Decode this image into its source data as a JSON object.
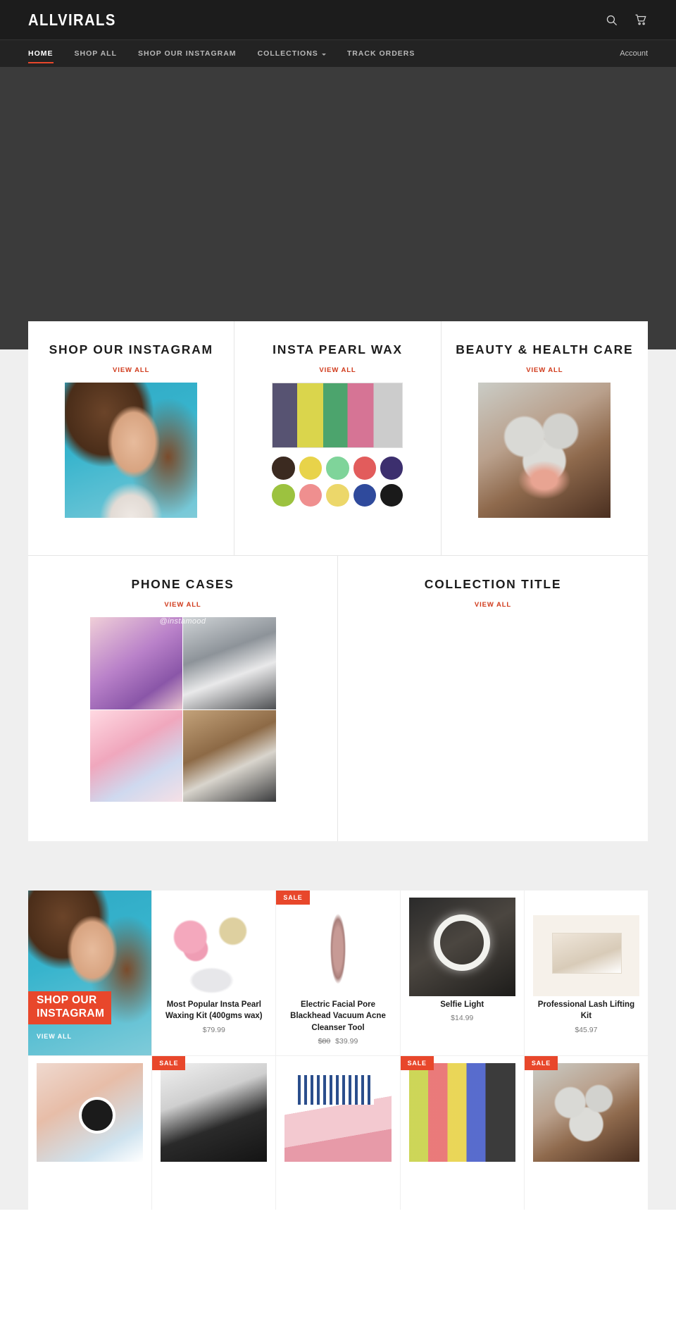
{
  "header": {
    "logo": "ALLVIRALS",
    "search_icon": "search-icon",
    "cart_icon": "cart-icon"
  },
  "nav": {
    "items": [
      {
        "label": "HOME",
        "active": true,
        "has_caret": false
      },
      {
        "label": "SHOP ALL",
        "active": false,
        "has_caret": false
      },
      {
        "label": "SHOP OUR INSTAGRAM",
        "active": false,
        "has_caret": false
      },
      {
        "label": "COLLECTIONS",
        "active": false,
        "has_caret": true
      },
      {
        "label": "TRACK ORDERS",
        "active": false,
        "has_caret": false
      }
    ],
    "account": "Account"
  },
  "collections": {
    "view_all": "VIEW ALL",
    "row1": [
      {
        "title": "SHOP OUR INSTAGRAM",
        "view_all": "VIEW ALL"
      },
      {
        "title": "INSTA PEARL WAX",
        "view_all": "VIEW ALL"
      },
      {
        "title": "BEAUTY & HEALTH CARE",
        "view_all": "VIEW ALL"
      }
    ],
    "row2": [
      {
        "title": "PHONE CASES",
        "view_all": "VIEW ALL"
      },
      {
        "title": "COLLECTION TITLE",
        "view_all": "VIEW ALL"
      }
    ],
    "wax_dot_colors": [
      "#3b2a20",
      "#e8d34a",
      "#7fd49a",
      "#e25c5c",
      "#3c2f6e",
      "#9cc23f",
      "#ef8f8f",
      "#ecd76a",
      "#2f4a9c",
      "#1a1a1a"
    ],
    "instamood_watermark": "@instamood"
  },
  "promo_tile": {
    "line1": "SHOP OUR",
    "line2": "INSTAGRAM",
    "view_all": "VIEW ALL"
  },
  "products": {
    "sale_label": "SALE",
    "row1": [
      {
        "title": "Most Popular Insta Pearl Waxing Kit (400gms wax)",
        "price": "$79.99",
        "was": "",
        "sale": false,
        "art": "art-wax"
      },
      {
        "title": "Electric Facial Pore Blackhead Vacuum Acne Cleanser Tool",
        "price": "$39.99",
        "was": "$80",
        "sale": true,
        "art": "art-vacuum"
      },
      {
        "title": "Selfie Light",
        "price": "$14.99",
        "was": "",
        "sale": false,
        "art": "art-selfie"
      },
      {
        "title": "Professional Lash Lifting Kit",
        "price": "$45.97",
        "was": "",
        "sale": false,
        "art": "art-lash"
      }
    ],
    "row2": [
      {
        "title": "",
        "price": "",
        "was": "",
        "sale": false,
        "art": "art-teeth"
      },
      {
        "title": "",
        "price": "",
        "was": "",
        "sale": true,
        "art": "art-blackmask"
      },
      {
        "title": "",
        "price": "",
        "was": "",
        "sale": false,
        "art": "art-whitening"
      },
      {
        "title": "",
        "price": "",
        "was": "",
        "sale": true,
        "art": "art-pearlpack"
      },
      {
        "title": "",
        "price": "",
        "was": "",
        "sale": true,
        "art": "art-foam"
      }
    ]
  },
  "colors": {
    "header_bg": "#1c1c1c",
    "nav_bg": "#232323",
    "accent": "#e8472b",
    "view_all": "#d0391a",
    "hero_bg": "#3b3b3b",
    "page_bg": "#efefef"
  }
}
